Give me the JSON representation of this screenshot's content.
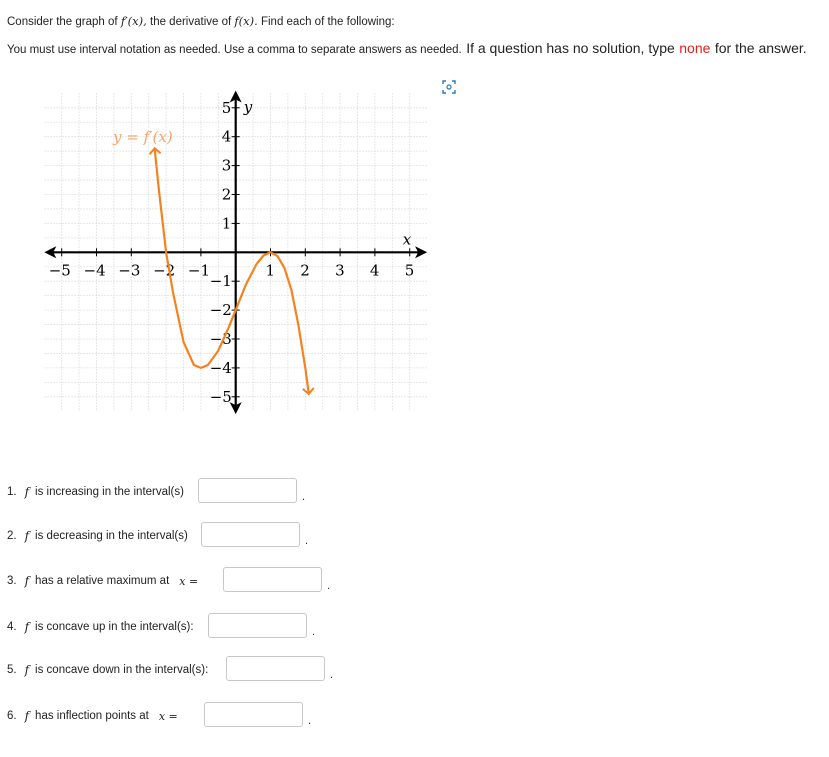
{
  "intro": {
    "part1": "Consider the graph of",
    "fprime": "f′(x),",
    "part2": "the derivative of",
    "f": "f(x).",
    "part3": "Find each of the following:"
  },
  "instructions": {
    "small": "You must use interval notation as needed. Use a comma to separate answers as needed.",
    "big1": "If a question has no  solution,  type",
    "none": "none",
    "big2": "for the answer."
  },
  "colors": {
    "curve": "#f58220",
    "none_text": "#e0201b"
  },
  "icons": {
    "expand": "expand-image-icon"
  },
  "chart_data": {
    "type": "line",
    "title": "",
    "curve_label": "y = f′(x)",
    "xlabel": "x",
    "ylabel": "y",
    "xlim": [
      -5,
      5
    ],
    "ylim": [
      -5,
      5
    ],
    "grid": true,
    "x_ticks": [
      "−5",
      "−4",
      "−3",
      "−2",
      "−1",
      "1",
      "2",
      "3",
      "4",
      "5"
    ],
    "y_ticks": [
      "5",
      "4",
      "3",
      "2",
      "1",
      "−1",
      "−2",
      "−3",
      "−4",
      "−5"
    ],
    "series": [
      {
        "x": [
          -2.33,
          -2.2,
          -2,
          -1.8,
          -1.5,
          -1.2,
          -1,
          -0.8,
          -0.5,
          -0.2,
          0,
          0.3,
          0.6,
          0.8,
          1,
          1.2,
          1.4,
          1.6,
          1.8,
          2,
          2.1
        ],
        "y": [
          3.6,
          2.1,
          0,
          -1.4,
          -3.1,
          -3.9,
          -4,
          -3.9,
          -3.4,
          -2.6,
          -2,
          -1.1,
          -0.4,
          -0.11,
          0,
          -0.13,
          -0.54,
          -1.3,
          -2.5,
          -4,
          -4.9
        ]
      }
    ],
    "arrows": "both ends"
  },
  "questions": [
    {
      "num": "1.",
      "f": "f",
      "text": "is increasing in the interval(s)",
      "value": "",
      "suffix": "."
    },
    {
      "num": "2.",
      "f": "f",
      "text": "is decreasing in the interval(s)",
      "value": "",
      "suffix": "."
    },
    {
      "num": "3.",
      "f": "f",
      "text": "has a relative maximum at",
      "mathx": "x =",
      "value": "",
      "suffix": "."
    },
    {
      "num": "4.",
      "f": "f",
      "text": "is concave up in the interval(s):",
      "value": "",
      "suffix": "."
    },
    {
      "num": "5.",
      "f": "f",
      "text": "is concave down  in the interval(s):",
      "value": "",
      "suffix": "."
    },
    {
      "num": "6.",
      "f": "f",
      "text": "has inflection points at",
      "mathx": "x =",
      "value": "",
      "suffix": "."
    }
  ]
}
